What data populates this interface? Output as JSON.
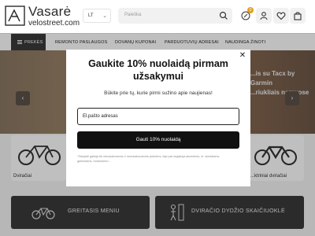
{
  "header": {
    "logo_name": "Vasarė",
    "logo_domain": "velostreet.com",
    "language": "LT",
    "search_placeholder": "Paieška",
    "cart_badge": "0",
    "icons": [
      "search-icon",
      "percent-icon",
      "user-icon",
      "heart-icon",
      "bag-icon"
    ]
  },
  "nav": {
    "items": [
      {
        "label": "PREKĖS"
      },
      {
        "label": "REMONTO PASLAUGOS"
      },
      {
        "label": "DOVANŲ KUPONAI"
      },
      {
        "label": "PARDUOTUVIŲ ADRESAI"
      },
      {
        "label": "NAUDINGA ŽINOTI"
      }
    ]
  },
  "hero": {
    "text_line1": "...is su Tacx by Garmin",
    "text_line2": "...riukliais namuose"
  },
  "cards": {
    "left_label": "Dviračiai",
    "right_label": "...ktriniai dviračiai"
  },
  "banners": {
    "left": "GREITASIS MENIU",
    "right": "DVIRAČIO DYDŽIO SKAIČIUOKLĖ"
  },
  "modal": {
    "title_line1": "Gaukite 10% nuolaidą pirmam",
    "title_line2": "užsakymui",
    "subtitle": "Būkite prie tų, kurie pirmi sužino apie naujienas!",
    "email_placeholder": "El.pašto adresas",
    "submit_label": "Gauti 10% nuolaidą",
    "fine_print_line1": "*Taisyklė galioja tik nenukainotoms ir nenukainuotoms prekėms, taip pat negalioja akcinėmis, el. dviračiams",
    "fine_print_line2": "gaminiams, motorolerio..."
  },
  "colors": {
    "dark": "#3a3a3a",
    "accent_badge": "#e0a11a",
    "button": "#111111"
  }
}
